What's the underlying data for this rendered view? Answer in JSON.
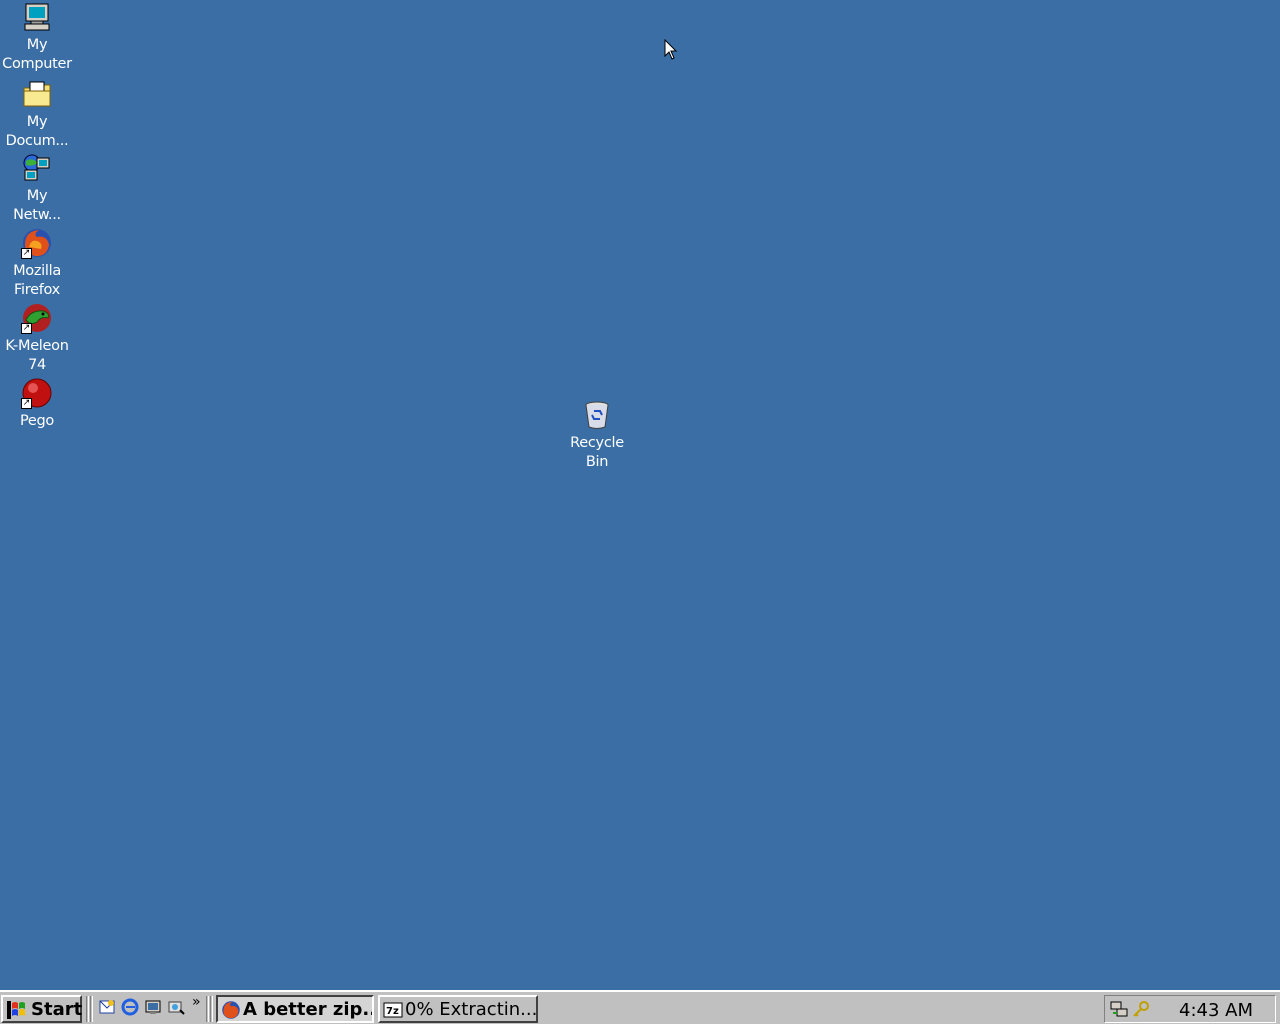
{
  "desktop": {
    "background": "#3a6ea5",
    "icons": [
      {
        "name": "my-computer-icon",
        "label": "My\nComputer",
        "shortcut": false
      },
      {
        "name": "my-documents-icon",
        "label": "My\nDocum...",
        "shortcut": false
      },
      {
        "name": "my-network-icon",
        "label": "My\nNetw...",
        "shortcut": false
      },
      {
        "name": "firefox-icon",
        "label": "Mozilla\nFirefox",
        "shortcut": true
      },
      {
        "name": "k-meleon-icon",
        "label": "K-Meleon\n74",
        "shortcut": true
      },
      {
        "name": "pego-icon",
        "label": "Pego",
        "shortcut": true
      }
    ],
    "recycle_bin": {
      "name": "recycle-bin-icon",
      "label": "Recycle\nBin"
    }
  },
  "taskbar": {
    "start_label": "Start",
    "quick_launch": [
      "outlook-express-icon",
      "internet-explorer-icon",
      "show-desktop-icon",
      "media-icon"
    ],
    "chevron": "»",
    "tasks": [
      {
        "label": "A better zip...",
        "icon": "firefox-icon",
        "active": true
      },
      {
        "label": "0% Extractin...",
        "icon": "7zip-icon",
        "active": false
      }
    ],
    "tray_icons": [
      "network-icon",
      "key-icon"
    ],
    "clock": "4:43 AM"
  }
}
